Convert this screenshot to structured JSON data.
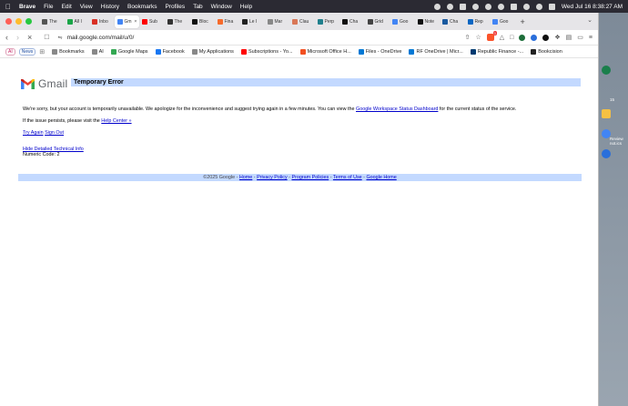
{
  "menubar": {
    "app": "Brave",
    "items": [
      "File",
      "Edit",
      "View",
      "History",
      "Bookmarks",
      "Profiles",
      "Tab",
      "Window",
      "Help"
    ],
    "clock": "Wed Jul 16  8:38:27 AM"
  },
  "tabs": [
    {
      "label": "The",
      "color": "#555"
    },
    {
      "label": "All I",
      "color": "#1ba548"
    },
    {
      "label": "Inbo",
      "color": "#d93025"
    },
    {
      "label": "Gm",
      "color": "#4285f4",
      "active": true
    },
    {
      "label": "Sub",
      "color": "#ff0000"
    },
    {
      "label": "The",
      "color": "#333"
    },
    {
      "label": "Bloc",
      "color": "#111"
    },
    {
      "label": "Fina",
      "color": "#f66b2b"
    },
    {
      "label": "Le I",
      "color": "#222"
    },
    {
      "label": "Mar",
      "color": "#888"
    },
    {
      "label": "Clau",
      "color": "#d97757"
    },
    {
      "label": "Perp",
      "color": "#20808d"
    },
    {
      "label": "Cha",
      "color": "#111"
    },
    {
      "label": "Grid",
      "color": "#444"
    },
    {
      "label": "Goo",
      "color": "#4285f4"
    },
    {
      "label": "Note",
      "color": "#111"
    },
    {
      "label": "Cha",
      "color": "#1a5aa0"
    },
    {
      "label": "Rep",
      "color": "#0a66c2"
    },
    {
      "label": "Goo",
      "color": "#4285f4"
    }
  ],
  "toolbar": {
    "url": "mail.google.com/mail/u/0/",
    "brave_badge": "3"
  },
  "bookmarks": {
    "ai_label": "AI",
    "news_label": "News",
    "items": [
      {
        "label": "Bookmarks",
        "color": "#888"
      },
      {
        "label": "AI",
        "color": "#888"
      },
      {
        "label": "Google Maps",
        "color": "#34a853"
      },
      {
        "label": "Facebook",
        "color": "#1877f2"
      },
      {
        "label": "My Applications",
        "color": "#888"
      },
      {
        "label": "Subscriptions - Yo...",
        "color": "#ff0000"
      },
      {
        "label": "Microsoft Office H...",
        "color": "#f25022"
      },
      {
        "label": "Files - OneDrive",
        "color": "#0078d4"
      },
      {
        "label": "RF OneDrive | Micr...",
        "color": "#0078d4"
      },
      {
        "label": "Republic Finance -...",
        "color": "#003a70"
      },
      {
        "label": "Bookcision",
        "color": "#222"
      }
    ]
  },
  "page": {
    "logo_text": "Gmail",
    "title": "Temporary Error",
    "message_pre": "We're sorry, but your account is temporarily unavailable. We apologize for the inconvenience and suggest trying again in a few minutes. You can view the ",
    "status_link": "Google Workspace Status Dashboard",
    "message_post": " for the current status of the service.",
    "persist_pre": "If the issue persists, please visit the ",
    "help_link": "Help Center »",
    "try_again": "Try Again",
    "sign_out": "Sign Out",
    "hide_details": "Hide Detailed Technical Info",
    "numeric_code": "Numeric Code: 2",
    "footer": {
      "copyright": "©2025 Google - ",
      "home": "Home",
      "privacy": "Privacy Policy",
      "program": "Program Policies",
      "terms": "Terms of Use",
      "google_home": "Google Home",
      "sep": " - "
    }
  },
  "desktop": {
    "side_text_1": "15",
    "side_text_2": "Review",
    "side_text_3": "not.ics"
  }
}
